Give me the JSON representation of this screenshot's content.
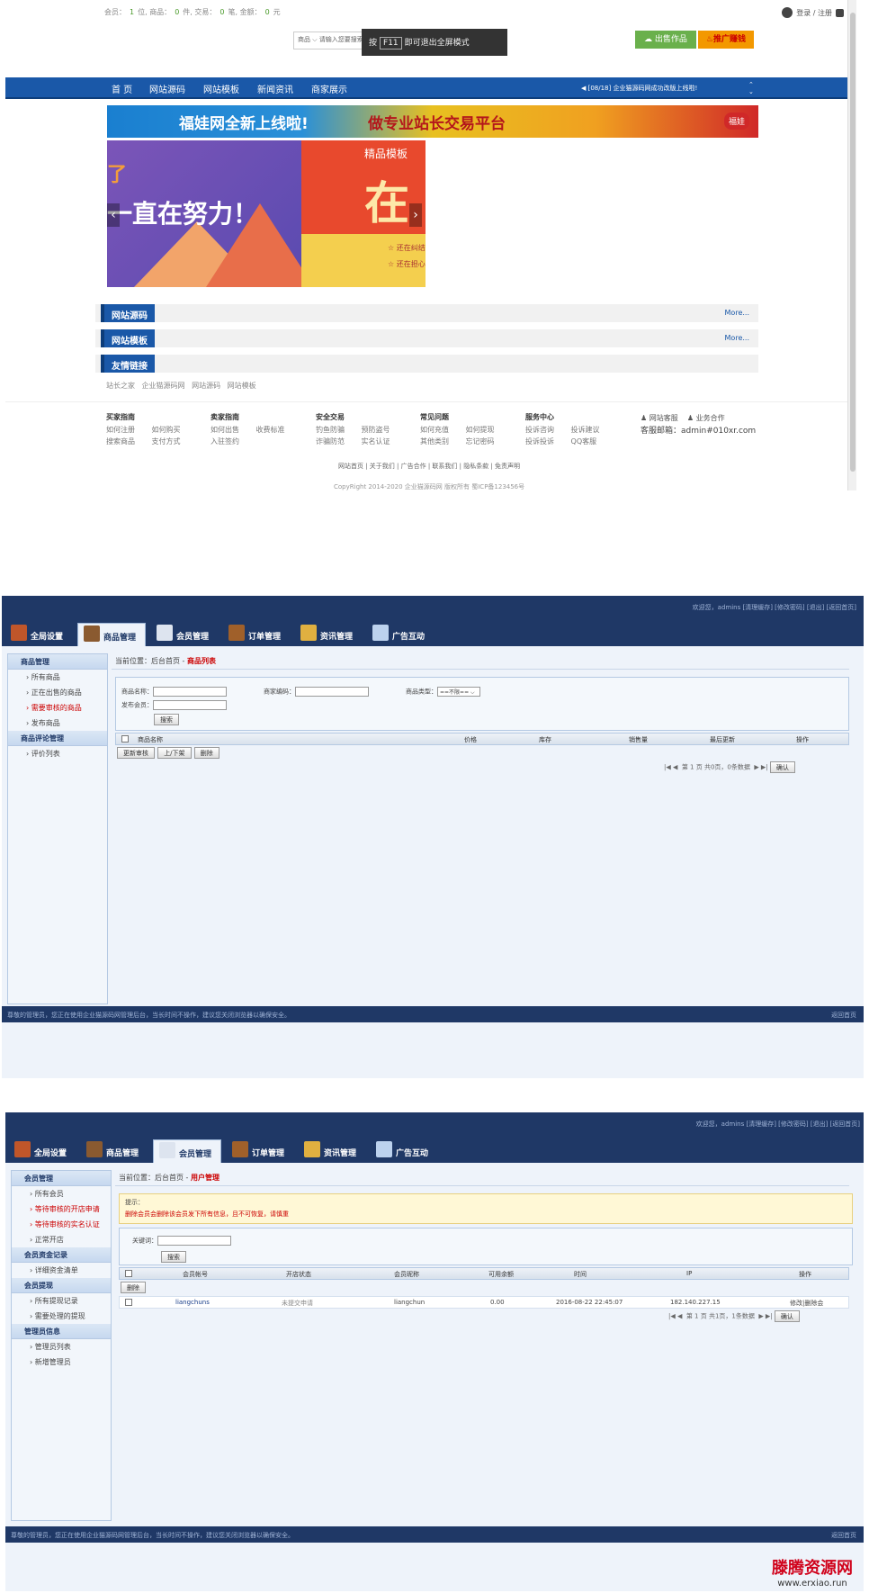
{
  "front": {
    "stats": {
      "member_label": "会员：",
      "member_count": "1",
      "member_unit": "位,",
      "goods_label": "商品：",
      "goods_count": "0",
      "goods_unit": "件,",
      "trade_label": "交易：",
      "trade_count": "0",
      "trade_unit": "笔,",
      "amount_label": "金额：",
      "amount_count": "0",
      "amount_unit": "元"
    },
    "login_text": "登录 / 注册",
    "search_type": "商品",
    "search_placeholder": "请输入您要搜索",
    "fullscreen_tip_pre": "按",
    "fullscreen_key": "F11",
    "fullscreen_tip_post": "即可退出全屏模式",
    "sell_button": "出售作品",
    "promo_button": "推广赚钱",
    "nav": [
      "首 页",
      "网站源码",
      "网站模板",
      "新闻资讯",
      "商家展示"
    ],
    "notice": "[08/18] 企业猫源码网成功改版上线啦!",
    "banner_left": "福娃网全新上线啦!",
    "banner_right": "做专业站长交易平台",
    "banner_badge": "福娃",
    "slide1_text": "一直在努力！",
    "slide1_small": "了",
    "slide2_title": "精品模板",
    "slide2_big": "在",
    "slide2_line1": "还在纠结",
    "slide2_line2": "还在担心",
    "sections": [
      {
        "title": "网站源码",
        "more": "More..."
      },
      {
        "title": "网站模板",
        "more": "More..."
      },
      {
        "title": "友情链接",
        "more": ""
      }
    ],
    "friend_links": "站长之家 企业猫源码网 网站源码 网站模板",
    "footer_cols": [
      {
        "title": "买家指南",
        "r1": "如何注册 如何购买",
        "r2": "搜索商品 支付方式"
      },
      {
        "title": "卖家指南",
        "r1": "如何出售 收费标准",
        "r2": "入驻签约"
      },
      {
        "title": "安全交易",
        "r1": "钓鱼防骗 预防盗号",
        "r2": "诈骗防范 实名认证"
      },
      {
        "title": "常见问题",
        "r1": "如何充值 如何提现",
        "r2": "其他类别 忘记密码"
      },
      {
        "title": "服务中心",
        "r1": "投诉咨询 投诉建议",
        "r2": "投诉投诉 QQ客服"
      }
    ],
    "footer_right_1": "网站客服",
    "footer_right_2": "业务合作",
    "footer_mail": "客服邮箱：admin#010xr.com",
    "footer_nav": "网站首页 | 关于我们 | 广告合作 | 联系我们 | 隐私条款 | 免责声明",
    "footer_copy": "CopyRight 2014-2020 企业猫源码网 版权所有 蜀ICP备123456号"
  },
  "admin1": {
    "header_links": "欢迎您，admins [清理缓存] [修改密码] [退出] [返回首页]",
    "tabs": [
      "全局设置",
      "商品管理",
      "会员管理",
      "订单管理",
      "资讯管理",
      "广告互动"
    ],
    "side": [
      {
        "group": "商品管理",
        "items": [
          "所有商品",
          "正在出售的商品",
          "需要审核的商品",
          "发布商品"
        ]
      },
      {
        "group": "商品评论管理",
        "items": [
          "评价列表"
        ]
      }
    ],
    "crumb_pre": "当前位置：后台首页 - ",
    "crumb_cur": "商品列表",
    "f_name": "商品名称：",
    "f_code": "商家编码：",
    "f_type": "商品类型：",
    "f_type_value": "==不限==",
    "f_pub": "发布会员：",
    "search_btn": "搜索",
    "cols": [
      "商品名称",
      "价格",
      "库存",
      "销售量",
      "最后更新",
      "操作"
    ],
    "act_btns": [
      "更新审核",
      "上/下架",
      "删除"
    ],
    "pager_text": "第 1 页 共0页，0条数据",
    "confirm": "确认",
    "footer_left": "尊敬的管理员，您正在使用企业猫源码网管理后台，当长时间不操作，建议您关闭浏览器以确保安全。",
    "footer_right": "返回首页"
  },
  "admin2": {
    "header_links": "欢迎您，admins [清理缓存] [修改密码] [退出] [返回首页]",
    "tabs": [
      "全局设置",
      "商品管理",
      "会员管理",
      "订单管理",
      "资讯管理",
      "广告互动"
    ],
    "side": [
      {
        "group": "会员管理",
        "items": [
          "所有会员",
          "等待审核的开店申请",
          "等待审核的实名认证",
          "正常开店"
        ]
      },
      {
        "group": "会员资金记录",
        "items": [
          "详细资金清单"
        ]
      },
      {
        "group": "会员提现",
        "items": [
          "所有提现记录",
          "需要处理的提现"
        ]
      },
      {
        "group": "管理员信息",
        "items": [
          "管理员列表",
          "新增管理员"
        ]
      }
    ],
    "crumb_pre": "当前位置：后台首页 - ",
    "crumb_cur": "用户管理",
    "tip_title": "提示：",
    "tip_text": "删除会员会删除该会员发下所有信息，且不可恢复，请慎重",
    "keyword": "关键词：",
    "search_btn": "搜索",
    "cols": [
      "会员帐号",
      "开店状态",
      "会员昵称",
      "可用余额",
      "时间",
      "IP",
      "操作"
    ],
    "delete_btn": "删除",
    "rows": [
      {
        "account": "liangchuns",
        "status": "未提交申请",
        "nick": "liangchun",
        "balance": "0.00",
        "time": "2016-08-22 22:45:07",
        "ip": "182.140.227.15",
        "op": "修改|删除会"
      }
    ],
    "pager_text": "第 1 页 共1页，1条数据",
    "confirm": "确认",
    "footer_left": "尊敬的管理员，您正在使用企业猫源码网管理后台，当长时间不操作，建议您关闭浏览器以确保安全。",
    "footer_right": "返回首页"
  },
  "watermark": {
    "line1": "滕腾资源网",
    "line2": "www.erxiao.run"
  }
}
